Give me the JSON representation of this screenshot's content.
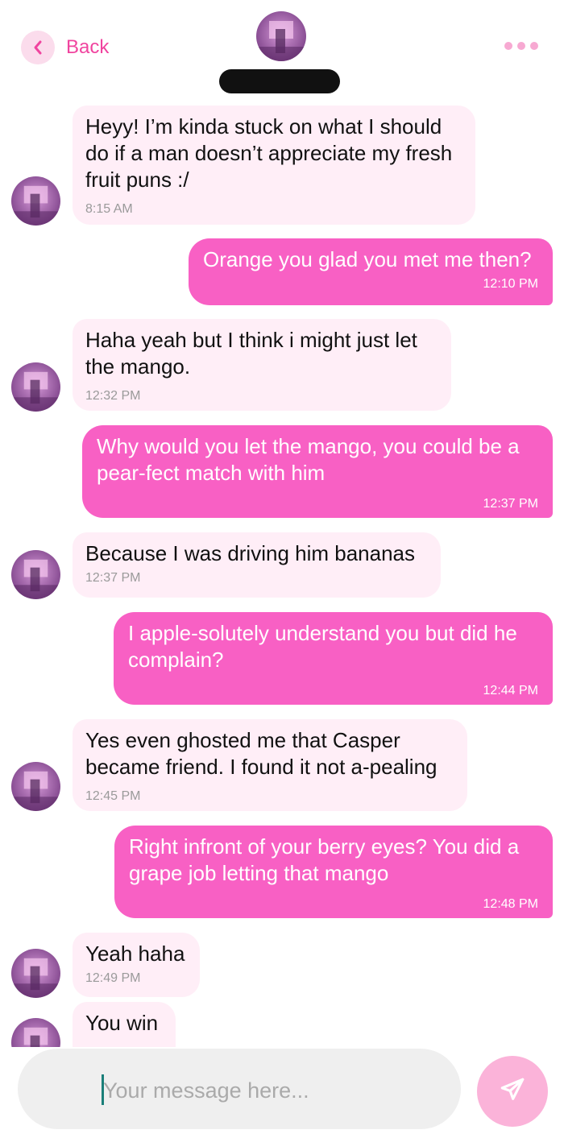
{
  "header": {
    "back_label": "Back",
    "contact_name": ""
  },
  "messages": [
    {
      "side": "in",
      "text": "Heyy! I’m kinda stuck on what I should do if a man doesn’t appreciate my fresh fruit puns :/",
      "time": "8:15 AM"
    },
    {
      "side": "out",
      "text": "Orange you glad you met me then?",
      "time": "12:10 PM"
    },
    {
      "side": "in",
      "text": "Haha yeah but I think i might just let the mango.",
      "time": "12:32 PM"
    },
    {
      "side": "out",
      "text": "Why would you let the mango, you could be a pear-fect match with him",
      "time": "12:37 PM"
    },
    {
      "side": "in",
      "text": "Because I was driving him bananas",
      "time": "12:37 PM"
    },
    {
      "side": "out",
      "text": "I apple-solutely understand you but did he complain?",
      "time": "12:44 PM"
    },
    {
      "side": "in",
      "text": "Yes even ghosted me that Casper became friend. I found it not a-pealing",
      "time": "12:45 PM"
    },
    {
      "side": "out",
      "text": "Right infront of your berry eyes? You did a grape job letting that mango",
      "time": "12:48 PM"
    },
    {
      "side": "in",
      "text": "Yeah haha",
      "time": "12:49 PM"
    },
    {
      "side": "in",
      "text": "You win",
      "time": ""
    }
  ],
  "composer": {
    "placeholder": "Your message here...",
    "value": ""
  },
  "colors": {
    "accent": "#f0449f",
    "outgoing_bubble": "#f860c4",
    "incoming_bubble": "#ffeef7",
    "send_button": "#fbb3d9"
  },
  "icons": {
    "back": "chevron-left-icon",
    "more": "more-dots-icon",
    "send": "paper-plane-icon"
  }
}
